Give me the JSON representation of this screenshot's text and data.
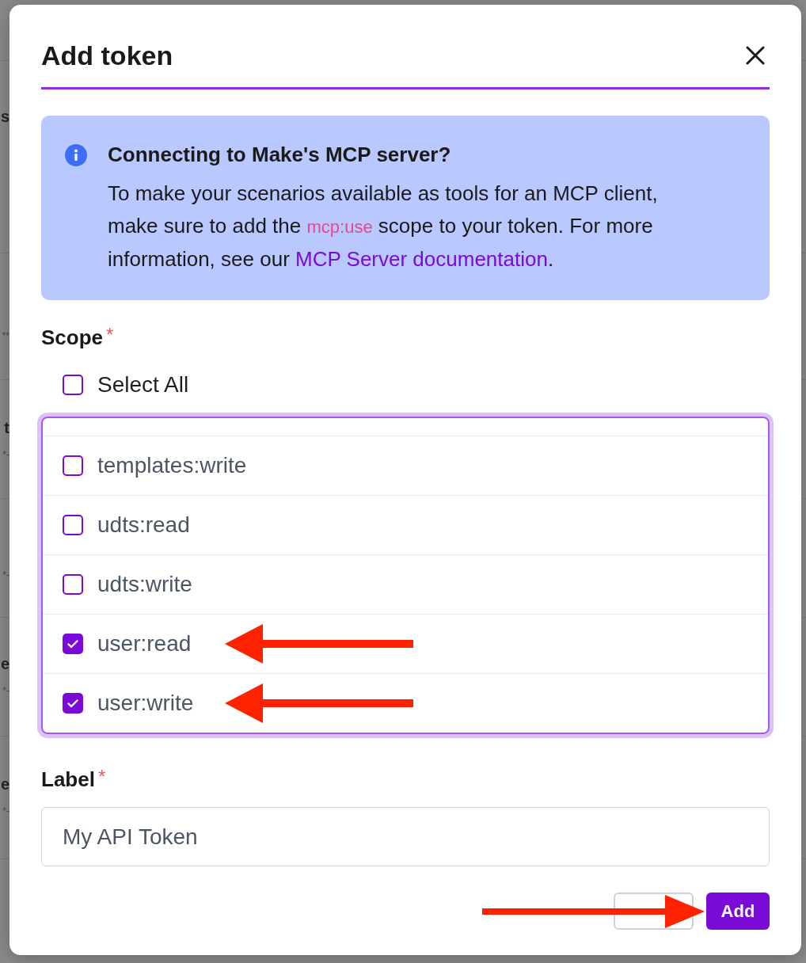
{
  "background": {
    "sections": [
      {
        "title": "s"
      },
      {
        "detail": "**"
      },
      {
        "title": "t",
        "detail": "*-"
      },
      {
        "detail": "*-"
      },
      {
        "title": "e",
        "detail": "*-"
      },
      {
        "title": "e",
        "detail": "*-"
      }
    ]
  },
  "dialog": {
    "title": "Add token",
    "info": {
      "title": "Connecting to Make's MCP server?",
      "body": [
        {
          "kind": "text",
          "text": "To make your scenarios available as tools for an MCP client, make sure to add the "
        },
        {
          "kind": "code",
          "text": "mcp:use"
        },
        {
          "kind": "text",
          "text": " scope to your token. For more information, see our "
        },
        {
          "kind": "link",
          "text": "MCP Server documentation"
        },
        {
          "kind": "text",
          "text": "."
        }
      ]
    },
    "scope": {
      "label": "Scope",
      "required_mark": "*",
      "select_all": {
        "label": "Select All",
        "checked": false
      },
      "items": [
        {
          "label": "templates:write",
          "checked": false,
          "annotated": false
        },
        {
          "label": "udts:read",
          "checked": false,
          "annotated": false
        },
        {
          "label": "udts:write",
          "checked": false,
          "annotated": false
        },
        {
          "label": "user:read",
          "checked": true,
          "annotated": true
        },
        {
          "label": "user:write",
          "checked": true,
          "annotated": true
        }
      ]
    },
    "label_field": {
      "label": "Label",
      "required_mark": "*",
      "value": "My API Token"
    },
    "buttons": [
      {
        "kind": "secondary"
      },
      {
        "kind": "primary",
        "label": "Add"
      }
    ],
    "footer_arrow": true
  }
}
